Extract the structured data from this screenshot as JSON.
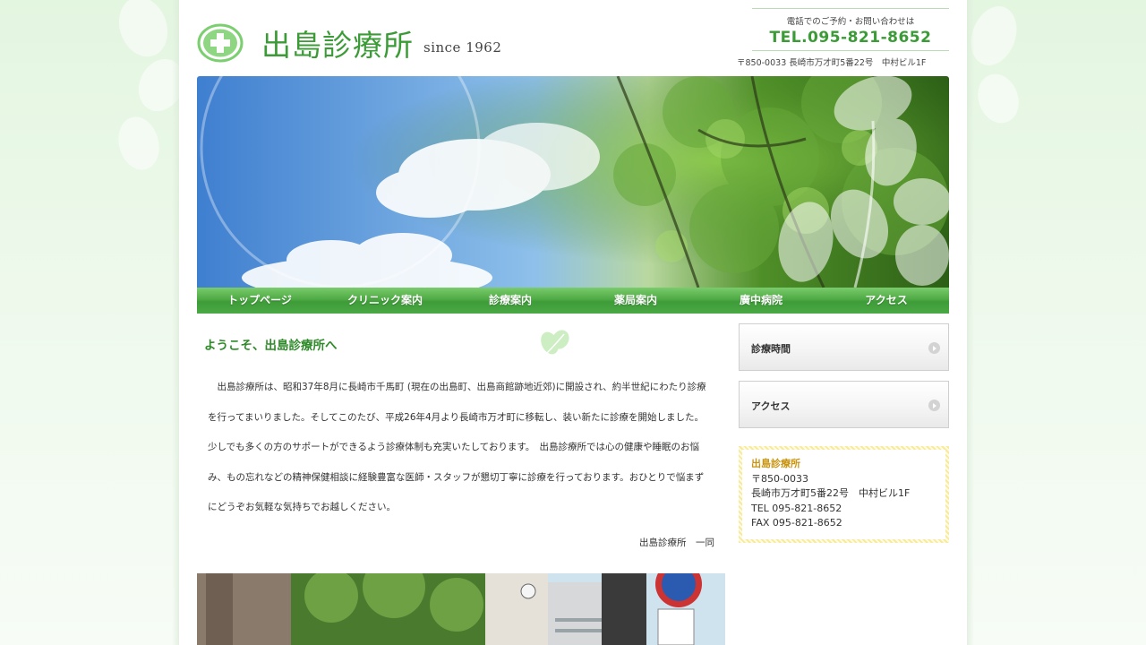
{
  "site": {
    "logo_text": "出島診療所",
    "since": "since 1962"
  },
  "header": {
    "contact_note": "電話でのご予約・お問い合わせは",
    "tel": "TEL.095-821-8652",
    "address": "〒850-0033 長崎市万才町5番22号　中村ビル1F"
  },
  "nav": {
    "items": [
      {
        "label": "トップページ"
      },
      {
        "label": "クリニック案内"
      },
      {
        "label": "診療案内"
      },
      {
        "label": "薬局案内"
      },
      {
        "label": "廣中病院"
      },
      {
        "label": "アクセス"
      }
    ]
  },
  "main": {
    "welcome_title": "ようこそ、出島診療所へ",
    "intro": "出島診療所は、昭和37年8月に長崎市千馬町 (現在の出島町、出島商館跡地近郊)に開設され、約半世紀にわたり診療を行ってまいりました。そしてこのたび、平成26年4月より長崎市万才町に移転し、装い新たに診療を開始しました。少しでも多くの方のサポートができるよう診療体制も充実いたしております。　出島診療所では心の健康や睡眠のお悩み、もの忘れなどの精神保健相談に経験豊富な医師・スタッフが懇切丁寧に診療を行っております。おひとりで悩まずにどうぞお気軽な気持ちでお越しください。",
    "signature": "出島診療所　一同"
  },
  "sidebar": {
    "buttons": [
      {
        "label": "診療時間"
      },
      {
        "label": "アクセス"
      }
    ],
    "info": {
      "name": "出島診療所",
      "postal": "〒850-0033",
      "address": "長崎市万才町5番22号　中村ビル1F",
      "tel": "TEL 095-821-8652",
      "fax": "FAX 095-821-8652"
    }
  },
  "colors": {
    "brand_green": "#3b9b36",
    "nav_green": "#4eaa44",
    "accent_gold": "#c89412"
  },
  "icons": {
    "logo": "green-cross-icon",
    "decoration": "leaf-icon",
    "button_arrow": "arrow-right-circle-icon"
  }
}
